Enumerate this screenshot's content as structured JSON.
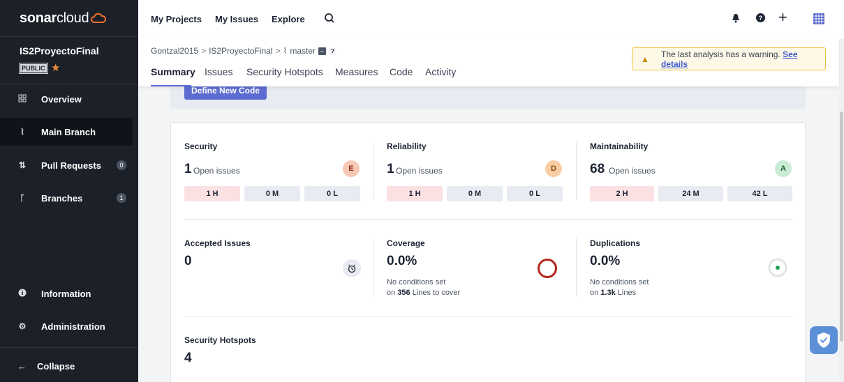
{
  "app": {
    "brand_bold": "sonar",
    "brand_light": "cloud"
  },
  "project": {
    "name": "IS2ProyectoFinal",
    "visibility": "PUBLIC"
  },
  "sidebar": {
    "items": [
      {
        "label": "Overview",
        "icon": "overview-grid-icon"
      },
      {
        "label": "Main Branch",
        "icon": "branch-icon"
      },
      {
        "label": "Pull Requests",
        "icon": "pull-request-icon",
        "count": "0"
      },
      {
        "label": "Branches",
        "icon": "branches-icon",
        "count": "1"
      },
      {
        "label": "Information",
        "icon": "info-icon"
      },
      {
        "label": "Administration",
        "icon": "gear-icon"
      }
    ],
    "collapse_label": "Collapse"
  },
  "topnav": {
    "links": [
      "My Projects",
      "My Issues",
      "Explore"
    ]
  },
  "breadcrumb": {
    "org": "Gontzal2015",
    "project": "IS2ProyectoFinal",
    "branch": "master"
  },
  "tabs": [
    "Summary",
    "Issues",
    "Security Hotspots",
    "Measures",
    "Code",
    "Activity"
  ],
  "warning": {
    "text": "The last analysis has a warning.",
    "link": "See details"
  },
  "new_code": {
    "button": "Define New Code"
  },
  "metrics": {
    "security": {
      "title": "Security",
      "value": "1",
      "open_label": "Open issues",
      "grade": "E",
      "high": "1 H",
      "medium": "0 M",
      "low": "0 L"
    },
    "reliability": {
      "title": "Reliability",
      "value": "1",
      "open_label": "Open issues",
      "grade": "D",
      "high": "1 H",
      "medium": "0 M",
      "low": "0 L"
    },
    "maintainability": {
      "title": "Maintainability",
      "value": "68",
      "open_label": "Open issues",
      "grade": "A",
      "high": "2 H",
      "medium": "24 M",
      "low": "42 L"
    },
    "accepted": {
      "title": "Accepted Issues",
      "value": "0"
    },
    "coverage": {
      "title": "Coverage",
      "value": "0.0%",
      "line1": "No conditions set",
      "line2_pre": "on",
      "line2_num": "356",
      "line2_post": "Lines to cover"
    },
    "duplications": {
      "title": "Duplications",
      "value": "0.0%",
      "line1": "No conditions set",
      "line2_pre": "on",
      "line2_num": "1.3k",
      "line2_post": "Lines"
    },
    "hotspots": {
      "title": "Security Hotspots",
      "value": "4"
    }
  },
  "colors": {
    "sidebar_bg": "#1b2029",
    "accent": "#5d6cd0",
    "grade_e": "#f7c9b5",
    "grade_d": "#f9cda3",
    "grade_a": "#c8ecd4",
    "coverage_ring": "#b5271f",
    "dup_dot": "#22a559"
  }
}
